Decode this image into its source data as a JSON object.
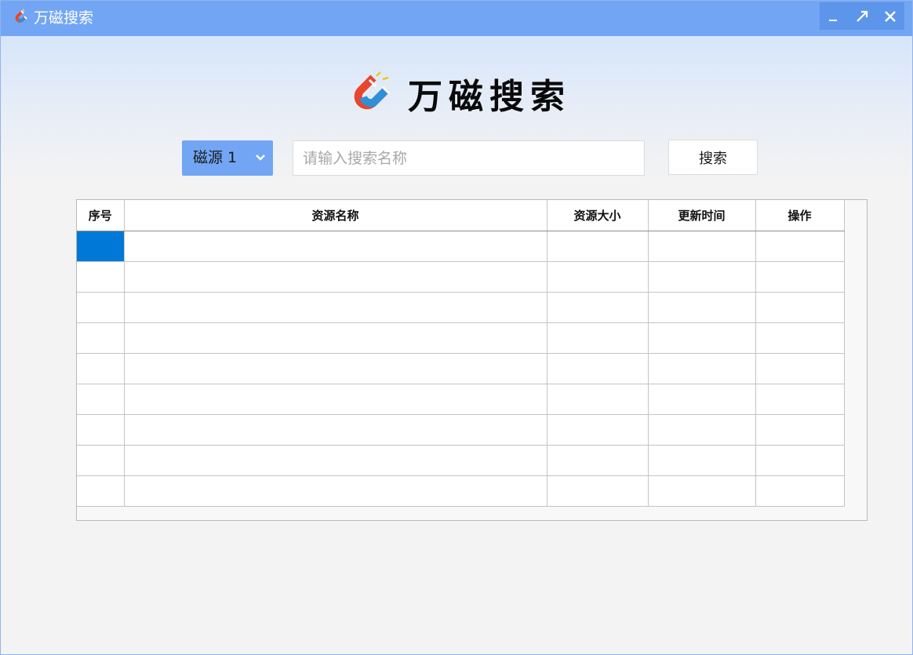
{
  "window": {
    "title": "万磁搜索",
    "icon": "magnet-icon",
    "controls": [
      "minimize-icon",
      "maximize-icon",
      "close-icon"
    ]
  },
  "logo": {
    "text": "万磁搜索",
    "icon": "magnet-icon"
  },
  "search": {
    "source_label": "磁源 1",
    "placeholder": "请输入搜索名称",
    "value": "",
    "button_label": "搜索"
  },
  "table": {
    "columns": [
      "序号",
      "资源名称",
      "资源大小",
      "更新时间",
      "操作"
    ],
    "rows": [
      [
        "",
        "",
        "",
        "",
        ""
      ],
      [
        "",
        "",
        "",
        "",
        ""
      ],
      [
        "",
        "",
        "",
        "",
        ""
      ],
      [
        "",
        "",
        "",
        "",
        ""
      ],
      [
        "",
        "",
        "",
        "",
        ""
      ],
      [
        "",
        "",
        "",
        "",
        ""
      ],
      [
        "",
        "",
        "",
        "",
        ""
      ],
      [
        "",
        "",
        "",
        "",
        ""
      ],
      [
        "",
        "",
        "",
        "",
        ""
      ]
    ]
  },
  "colors": {
    "titlebar": "#72a6f4",
    "accent": "#72a6f4",
    "selection": "#0078d7",
    "magnet_red": "#e8452c",
    "magnet_blue": "#2f8fd8"
  }
}
